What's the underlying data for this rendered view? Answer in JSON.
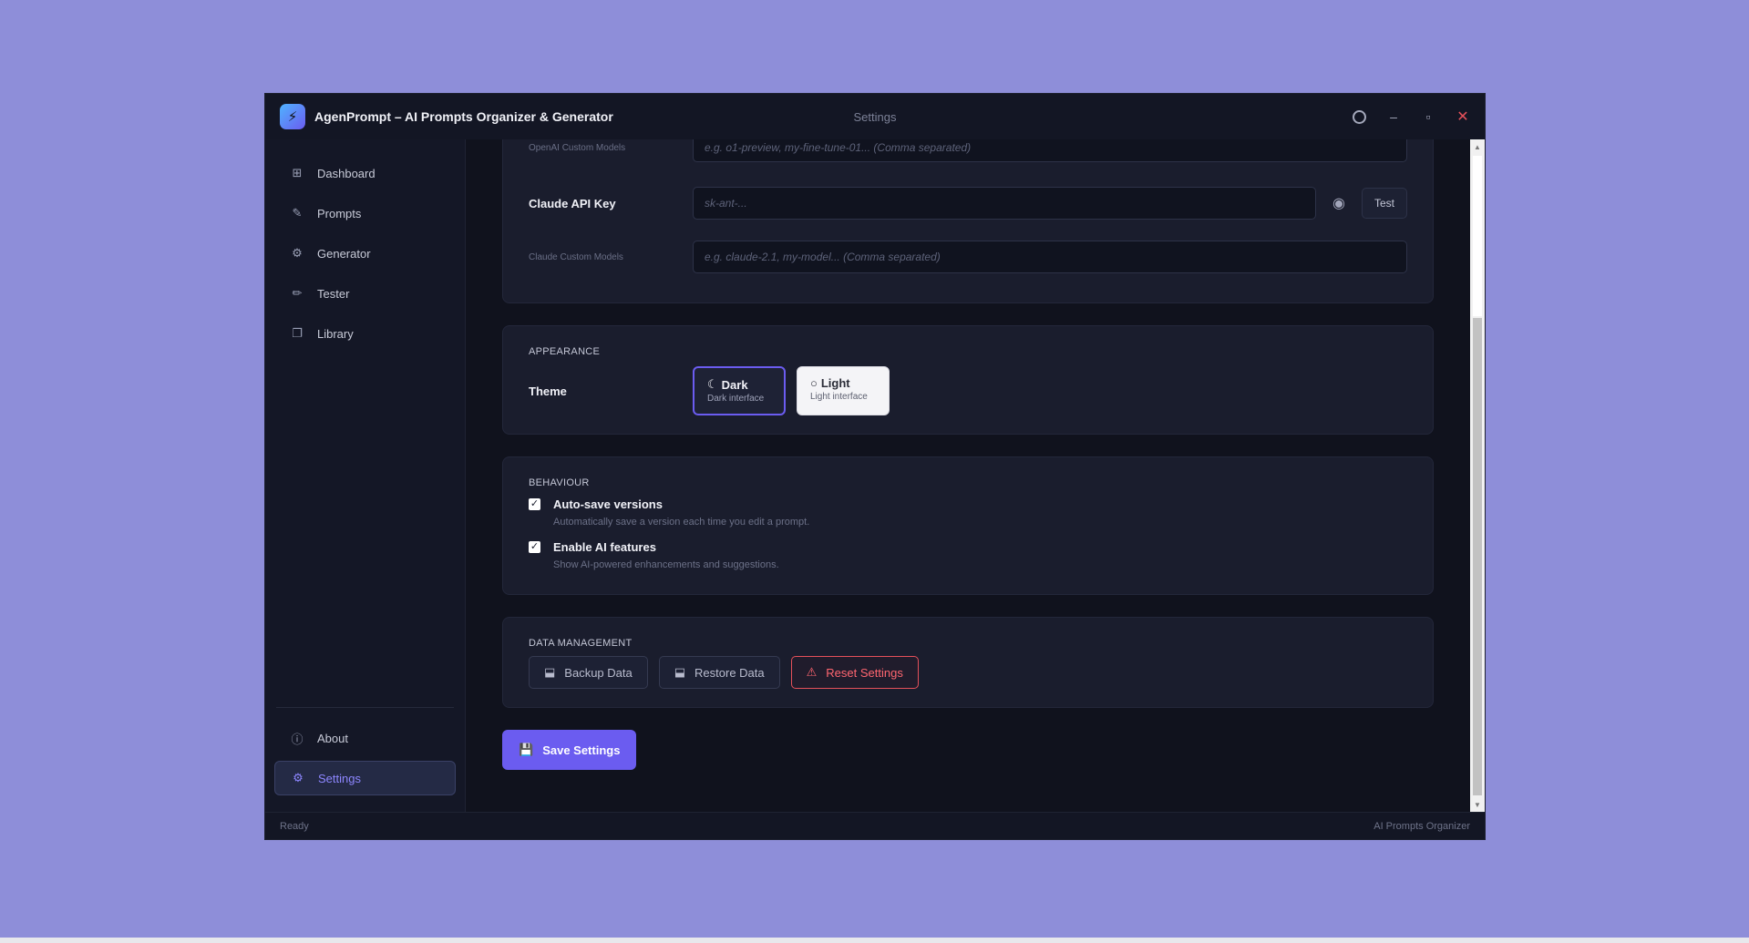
{
  "window": {
    "app_title": "AgenPrompt – AI Prompts Organizer & Generator",
    "center_title": "Settings",
    "controls": {
      "minimize": "–",
      "maximize": "▫",
      "close": "✕"
    }
  },
  "sidebar": {
    "items": [
      {
        "label": "Dashboard",
        "icon": "dashboard-icon",
        "glyph": "⊞"
      },
      {
        "label": "Prompts",
        "icon": "document-edit-icon",
        "glyph": "✎"
      },
      {
        "label": "Generator",
        "icon": "robot-icon",
        "glyph": "⚙"
      },
      {
        "label": "Tester",
        "icon": "pencil-icon",
        "glyph": "✏"
      },
      {
        "label": "Library",
        "icon": "library-icon",
        "glyph": "❐"
      }
    ],
    "bottom": [
      {
        "label": "About",
        "icon": "info-icon",
        "glyph": "ⓘ",
        "active": false
      },
      {
        "label": "Settings",
        "icon": "gear-icon",
        "glyph": "⚙",
        "active": true
      }
    ]
  },
  "api": {
    "openai_models_label": "OpenAI Custom Models",
    "openai_models_placeholder": "e.g. o1-preview, my-fine-tune-01... (Comma separated)",
    "claude_key_label": "Claude API Key",
    "claude_key_placeholder": "sk-ant-...",
    "test_label": "Test",
    "claude_models_label": "Claude Custom Models",
    "claude_models_placeholder": "e.g. claude-2.1, my-model... (Comma separated)"
  },
  "appearance": {
    "section": "APPEARANCE",
    "theme_label": "Theme",
    "dark": {
      "title": "Dark",
      "subtitle": "Dark interface"
    },
    "light": {
      "title": "Light",
      "subtitle": "Light interface"
    },
    "selected": "dark"
  },
  "behaviour": {
    "section": "BEHAVIOUR",
    "options": [
      {
        "title": "Auto-save versions",
        "subtitle": "Automatically save a version each time you edit a prompt.",
        "checked": true
      },
      {
        "title": "Enable AI features",
        "subtitle": "Show AI-powered enhancements and suggestions.",
        "checked": true
      }
    ]
  },
  "data_management": {
    "section": "DATA MANAGEMENT",
    "backup": "Backup Data",
    "restore": "Restore Data",
    "reset": "Reset Settings"
  },
  "save_label": "Save Settings",
  "status": {
    "left": "Ready",
    "right": "AI Prompts Organizer"
  },
  "colors": {
    "accent": "#6b5cf0",
    "danger": "#e5505a",
    "background": "#10121d"
  }
}
